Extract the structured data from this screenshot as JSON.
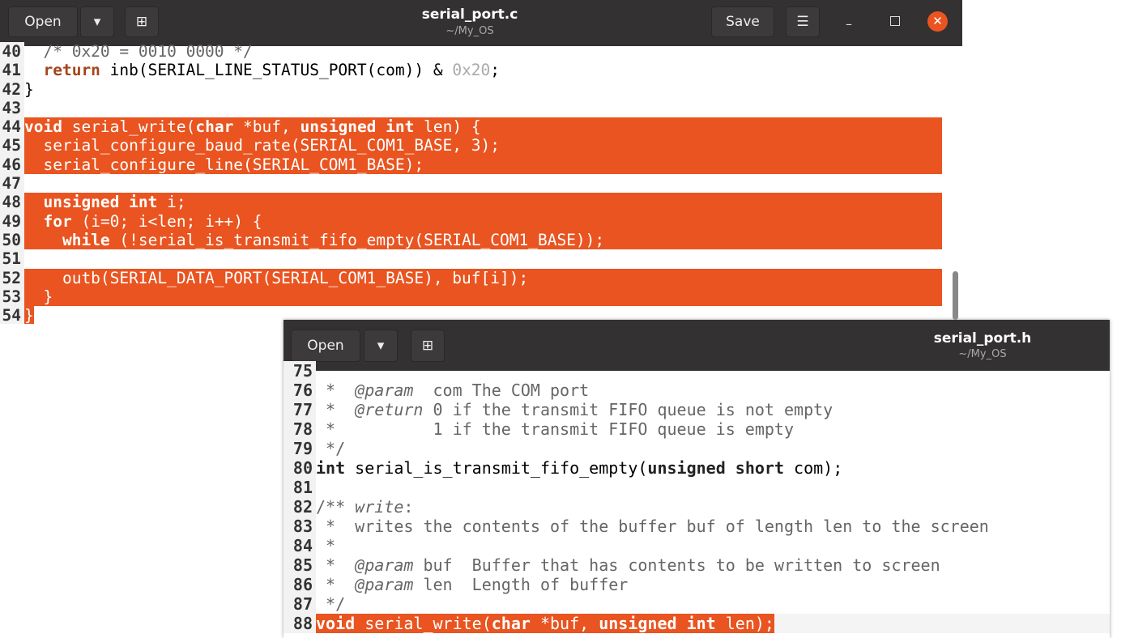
{
  "top": {
    "open": "Open",
    "save": "Save",
    "title": "serial_port.c",
    "path": "~/My_OS",
    "lines": [
      {
        "n": "40",
        "t": [
          [
            "  /* 0x20 = 0010 0000 */",
            "cm"
          ]
        ]
      },
      {
        "n": "41",
        "t": [
          [
            "  ",
            ""
          ],
          [
            "return",
            "kw"
          ],
          [
            " inb(SERIAL_LINE_STATUS_PORT(com)) & ",
            ""
          ],
          [
            "0x20",
            "nb"
          ],
          [
            ";",
            ""
          ]
        ]
      },
      {
        "n": "42",
        "t": [
          [
            "}",
            ""
          ]
        ]
      },
      {
        "n": "43",
        "t": [
          [
            "",
            ""
          ]
        ]
      },
      {
        "n": "44",
        "s": 1,
        "t": [
          [
            "void",
            "kw"
          ],
          [
            " serial_write(",
            ""
          ],
          [
            "char",
            "kw"
          ],
          [
            " *buf, ",
            ""
          ],
          [
            "unsigned int",
            "kw"
          ],
          [
            " len) {",
            ""
          ]
        ]
      },
      {
        "n": "45",
        "s": 1,
        "t": [
          [
            "  serial_configure_baud_rate(SERIAL_COM1_BASE, 3);",
            ""
          ]
        ]
      },
      {
        "n": "46",
        "s": 1,
        "t": [
          [
            "  serial_configure_line(SERIAL_COM1_BASE);",
            ""
          ]
        ]
      },
      {
        "n": "47",
        "s": 1,
        "t": [
          [
            "",
            ""
          ]
        ]
      },
      {
        "n": "48",
        "s": 1,
        "t": [
          [
            "  ",
            ""
          ],
          [
            "unsigned int",
            "kw"
          ],
          [
            " i;",
            ""
          ]
        ]
      },
      {
        "n": "49",
        "s": 1,
        "t": [
          [
            "  ",
            ""
          ],
          [
            "for",
            "kw"
          ],
          [
            " (i=0; i<len; i++) {",
            ""
          ]
        ]
      },
      {
        "n": "50",
        "s": 1,
        "t": [
          [
            "    ",
            ""
          ],
          [
            "while",
            "kw"
          ],
          [
            " (!serial_is_transmit_fifo_empty(SERIAL_COM1_BASE));",
            ""
          ]
        ]
      },
      {
        "n": "51",
        "s": 1,
        "t": [
          [
            "",
            ""
          ]
        ]
      },
      {
        "n": "52",
        "s": 1,
        "t": [
          [
            "    outb(SERIAL_DATA_PORT(SERIAL_COM1_BASE), buf[i]);",
            ""
          ]
        ]
      },
      {
        "n": "53",
        "s": 1,
        "t": [
          [
            "  }",
            ""
          ]
        ]
      },
      {
        "n": "54",
        "s": 2,
        "t": [
          [
            "}",
            ""
          ]
        ]
      }
    ]
  },
  "bottom": {
    "open": "Open",
    "title": "serial_port.h",
    "path": "~/My_OS",
    "lines": [
      {
        "n": "75",
        "t": [
          [
            "",
            ""
          ]
        ]
      },
      {
        "n": "76",
        "t": [
          [
            " *  ",
            "cm"
          ],
          [
            "@param",
            "cmi"
          ],
          [
            "  com The COM port",
            "cm"
          ]
        ]
      },
      {
        "n": "77",
        "t": [
          [
            " *  ",
            "cm"
          ],
          [
            "@return",
            "cmi"
          ],
          [
            " 0 if the transmit FIFO queue is not empty",
            "cm"
          ]
        ]
      },
      {
        "n": "78",
        "t": [
          [
            " *          1 if the transmit FIFO queue is empty",
            "cm"
          ]
        ]
      },
      {
        "n": "79",
        "t": [
          [
            " */",
            "cm"
          ]
        ]
      },
      {
        "n": "80",
        "t": [
          [
            "int",
            "ty"
          ],
          [
            " serial_is_transmit_fifo_empty(",
            ""
          ],
          [
            "unsigned short",
            "ty"
          ],
          [
            " com);",
            ""
          ]
        ]
      },
      {
        "n": "81",
        "t": [
          [
            "",
            ""
          ]
        ]
      },
      {
        "n": "82",
        "t": [
          [
            "/** ",
            "cm"
          ],
          [
            "write",
            "cmi"
          ],
          [
            ":",
            "cm"
          ]
        ]
      },
      {
        "n": "83",
        "t": [
          [
            " *  writes the contents of the buffer buf of length len to the screen",
            "cm"
          ]
        ]
      },
      {
        "n": "84",
        "t": [
          [
            " *",
            "cm"
          ]
        ]
      },
      {
        "n": "85",
        "t": [
          [
            " *  ",
            "cm"
          ],
          [
            "@param",
            "cmi"
          ],
          [
            " buf  Buffer that has contents to be written to screen",
            "cm"
          ]
        ]
      },
      {
        "n": "86",
        "t": [
          [
            " *  ",
            "cm"
          ],
          [
            "@param",
            "cmi"
          ],
          [
            " len  Length of buffer",
            "cm"
          ]
        ]
      },
      {
        "n": "87",
        "t": [
          [
            " */",
            "cm"
          ]
        ]
      },
      {
        "n": "88",
        "s": 3,
        "t": [
          [
            "void",
            "kw"
          ],
          [
            " serial_write(",
            ""
          ],
          [
            "char",
            "kw"
          ],
          [
            " *buf, ",
            ""
          ],
          [
            "unsigned int",
            "kw"
          ],
          [
            " len);",
            ""
          ]
        ]
      }
    ]
  }
}
